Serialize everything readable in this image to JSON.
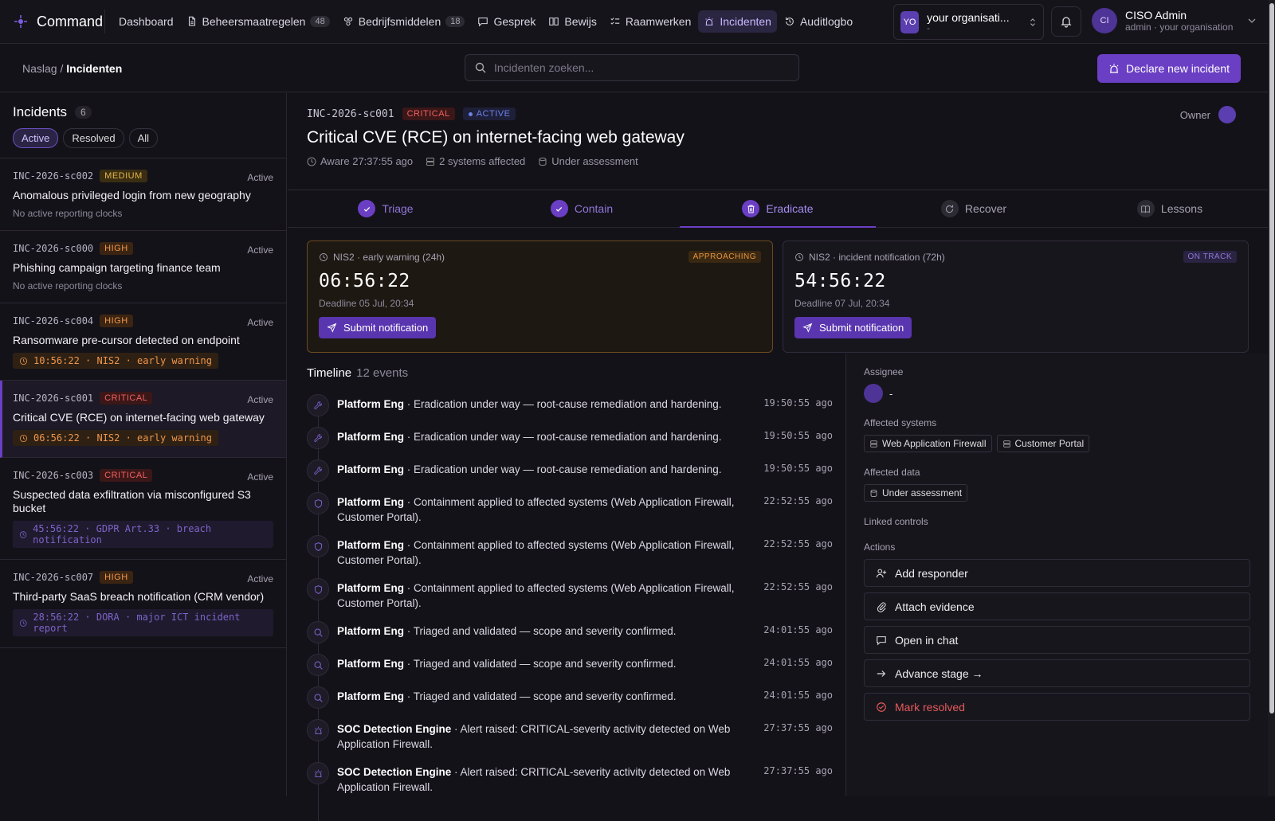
{
  "app": {
    "name": "Command"
  },
  "nav": [
    {
      "label": "Dashboard",
      "icon": "none"
    },
    {
      "label": "Beheersmaatregelen",
      "icon": "document-icon",
      "count": "48"
    },
    {
      "label": "Bedrijfsmiddelen",
      "icon": "assets-icon",
      "count": "18"
    },
    {
      "label": "Gesprek",
      "icon": "chat-icon"
    },
    {
      "label": "Bewijs",
      "icon": "book-icon"
    },
    {
      "label": "Raamwerken",
      "icon": "checklist-icon"
    },
    {
      "label": "Incidenten",
      "icon": "siren-icon",
      "active": true
    },
    {
      "label": "Auditlogbo",
      "icon": "history-icon"
    }
  ],
  "org": {
    "initials": "YO",
    "name": "your organisati...",
    "sub": "-"
  },
  "user": {
    "initials": "CI",
    "name": "CISO Admin",
    "sub": "admin · your organisation"
  },
  "breadcrumb": {
    "parent": "Naslag",
    "sep": "/",
    "current": "Incidenten"
  },
  "search": {
    "placeholder": "Incidenten zoeken..."
  },
  "declare_label": "Declare new incident",
  "list": {
    "title": "Incidents",
    "count": "6",
    "filters": [
      "Active",
      "Resolved",
      "All"
    ],
    "active_filter": "Active",
    "items": [
      {
        "id": "INC-2026-sc002",
        "severity": "MEDIUM",
        "status": "Active",
        "title": "Anomalous privileged login from new geography",
        "note": "No active reporting clocks"
      },
      {
        "id": "INC-2026-sc000",
        "severity": "HIGH",
        "status": "Active",
        "title": "Phishing campaign targeting finance team",
        "note": "No active reporting clocks"
      },
      {
        "id": "INC-2026-sc004",
        "severity": "HIGH",
        "status": "Active",
        "title": "Ransomware pre-cursor detected on endpoint",
        "clock": "10:56:22 · NIS2 · early warning",
        "clock_style": "orange"
      },
      {
        "id": "INC-2026-sc001",
        "severity": "CRITICAL",
        "status": "Active",
        "title": "Critical CVE (RCE) on internet-facing web gateway",
        "clock": "06:56:22 · NIS2 · early warning",
        "clock_style": "orange",
        "selected": true
      },
      {
        "id": "INC-2026-sc003",
        "severity": "CRITICAL",
        "status": "Active",
        "title": "Suspected data exfiltration via misconfigured S3 bucket",
        "clock": "45:56:22 · GDPR Art.33 · breach notification",
        "clock_style": "purple"
      },
      {
        "id": "INC-2026-sc007",
        "severity": "HIGH",
        "status": "Active",
        "title": "Third-party SaaS breach notification (CRM vendor)",
        "clock": "28:56:22 · DORA · major ICT incident report",
        "clock_style": "purple"
      }
    ]
  },
  "incident": {
    "id": "INC-2026-sc001",
    "severity": "CRITICAL",
    "state": "ACTIVE",
    "owner_label": "Owner",
    "title": "Critical CVE (RCE) on internet-facing web gateway",
    "meta": {
      "aware": "Aware 27:37:55 ago",
      "systems": "2 systems affected",
      "assessment": "Under assessment"
    }
  },
  "stages": [
    {
      "label": "Triage",
      "state": "done"
    },
    {
      "label": "Contain",
      "state": "done"
    },
    {
      "label": "Eradicate",
      "state": "current"
    },
    {
      "label": "Recover",
      "state": "todo"
    },
    {
      "label": "Lessons",
      "state": "todo"
    }
  ],
  "clocks": [
    {
      "label": "NIS2 · early warning (24h)",
      "status": "APPROACHING",
      "time": "06:56:22",
      "deadline": "Deadline 05 Jul, 20:34",
      "button": "Submit notification",
      "style": "warn"
    },
    {
      "label": "NIS2 · incident notification (72h)",
      "status": "ON TRACK",
      "time": "54:56:22",
      "deadline": "Deadline 07 Jul, 20:34",
      "button": "Submit notification",
      "style": "ok"
    }
  ],
  "timeline": {
    "title": "Timeline",
    "count": "12 events",
    "events": [
      {
        "actor": "Platform Eng",
        "text": "Eradication under way — root-cause remediation and hardening.",
        "time": "19:50:55 ago",
        "icon": "wrench-icon"
      },
      {
        "actor": "Platform Eng",
        "text": "Eradication under way — root-cause remediation and hardening.",
        "time": "19:50:55 ago",
        "icon": "wrench-icon"
      },
      {
        "actor": "Platform Eng",
        "text": "Eradication under way — root-cause remediation and hardening.",
        "time": "19:50:55 ago",
        "icon": "wrench-icon"
      },
      {
        "actor": "Platform Eng",
        "text": "Containment applied to affected systems (Web Application Firewall, Customer Portal).",
        "time": "22:52:55 ago",
        "icon": "shield-icon"
      },
      {
        "actor": "Platform Eng",
        "text": "Containment applied to affected systems (Web Application Firewall, Customer Portal).",
        "time": "22:52:55 ago",
        "icon": "shield-icon"
      },
      {
        "actor": "Platform Eng",
        "text": "Containment applied to affected systems (Web Application Firewall, Customer Portal).",
        "time": "22:52:55 ago",
        "icon": "shield-icon"
      },
      {
        "actor": "Platform Eng",
        "text": "Triaged and validated — scope and severity confirmed.",
        "time": "24:01:55 ago",
        "icon": "search-icon"
      },
      {
        "actor": "Platform Eng",
        "text": "Triaged and validated — scope and severity confirmed.",
        "time": "24:01:55 ago",
        "icon": "search-icon"
      },
      {
        "actor": "Platform Eng",
        "text": "Triaged and validated — scope and severity confirmed.",
        "time": "24:01:55 ago",
        "icon": "search-icon"
      },
      {
        "actor": "SOC Detection Engine",
        "text": "Alert raised: CRITICAL-severity activity detected on Web Application Firewall.",
        "time": "27:37:55 ago",
        "icon": "siren-icon"
      },
      {
        "actor": "SOC Detection Engine",
        "text": "Alert raised: CRITICAL-severity activity detected on Web Application Firewall.",
        "time": "27:37:55 ago",
        "icon": "siren-icon"
      }
    ]
  },
  "details": {
    "assignee_label": "Assignee",
    "assignee_value": "-",
    "systems_label": "Affected systems",
    "systems": [
      "Web Application Firewall",
      "Customer Portal"
    ],
    "data_label": "Affected data",
    "data": [
      "Under assessment"
    ],
    "controls_label": "Linked controls",
    "actions_label": "Actions",
    "actions": [
      {
        "label": "Add responder",
        "icon": "add-user-icon"
      },
      {
        "label": "Attach evidence",
        "icon": "paperclip-icon"
      },
      {
        "label": "Open in chat",
        "icon": "chat-icon"
      },
      {
        "label": "Advance stage →",
        "icon": "arrow-right-icon"
      },
      {
        "label": "Mark resolved",
        "icon": "check-circle-icon",
        "danger": true
      }
    ]
  }
}
